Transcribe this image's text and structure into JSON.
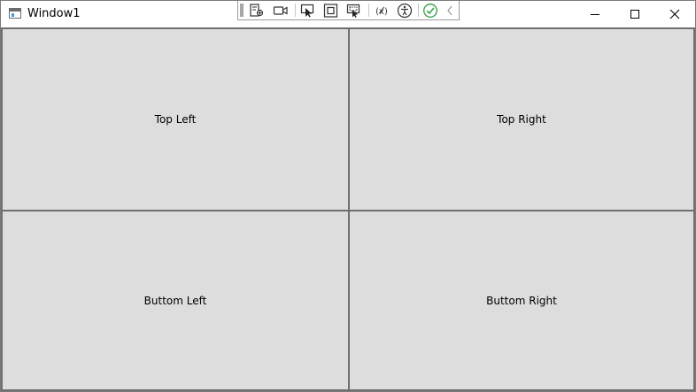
{
  "window": {
    "title": "Window1"
  },
  "debug_toolbar": {
    "buttons": [
      {
        "icon": "live-visual-tree-icon"
      },
      {
        "icon": "record-icon"
      },
      {
        "icon": "select-element-icon"
      },
      {
        "icon": "display-layout-adorners-icon"
      },
      {
        "icon": "track-focused-element-icon"
      },
      {
        "icon": "binding-failures-icon"
      },
      {
        "icon": "accessibility-icon"
      },
      {
        "icon": "check-icon"
      },
      {
        "icon": "collapse-chevron-icon"
      }
    ]
  },
  "cells": {
    "top_left": "Top Left",
    "top_right": "Top Right",
    "bottom_left": "Buttom Left",
    "bottom_right": "Buttom Right"
  },
  "colors": {
    "cell_background": "#dddddd",
    "cell_border": "#6f6f6f",
    "check_green": "#2e9e3e"
  }
}
